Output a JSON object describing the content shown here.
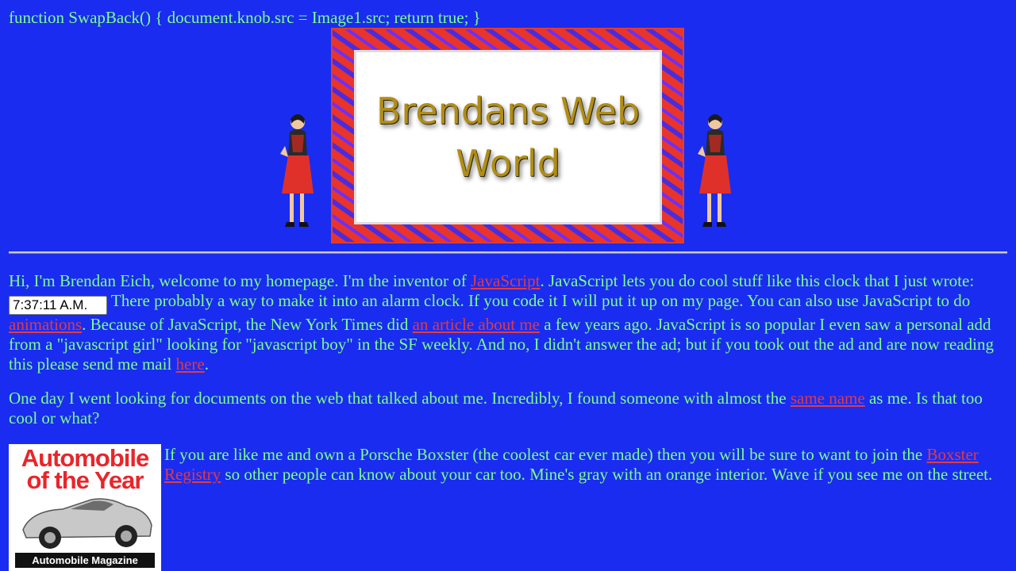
{
  "header": {
    "code_text": "function SwapBack() { document.knob.src = Image1.src; return true; }"
  },
  "banner": {
    "title_line1": "Brendans Web",
    "title_line2": "World"
  },
  "intro": {
    "text1": "Hi, I'm Brendan Eich, welcome to my homepage. I'm the inventor of ",
    "javascript_link": "JavaScript",
    "text2": ". JavaScript lets you do cool stuff like this clock that I just wrote: ",
    "clock_value": "7:37:11 A.M.",
    "text3": " There probably a way to make it into an alarm clock. If you code it I will put it up on my page. You can also use JavaScript to do ",
    "animations_link": "animations",
    "text4": ". Because of JavaScript, the New York Times did ",
    "article_link": "an article about me",
    "text5": " a few years ago. JavaScript is so popular I even saw a personal add from a \"javascript girl\" looking for \"javascript boy\" in the SF weekly. And no, I didn't answer the ad; but if you took out the ad and are now reading this please send me mail ",
    "here_link": "here",
    "text6": "."
  },
  "search": {
    "text1": "One day I went looking for documents on the web that talked about me. Incredibly, I found someone with almost the ",
    "same_name_link": "same name",
    "text2": " as me. Is that too cool or what?"
  },
  "boxster": {
    "magazine_title": "Automobile of the Year",
    "magazine_footer": "Automobile Magazine",
    "text1": "If you are like me and own a Porsche Boxster (the coolest car ever made) then you will be sure to want to join the ",
    "registry_link": "Boxster Registry",
    "text2": " so other people can know about your car too. Mine's gray with an orange interior. Wave if you see me on the street."
  },
  "colors": {
    "background": "#1a2cf0",
    "text": "#7dff86",
    "link": "#e23a44"
  }
}
